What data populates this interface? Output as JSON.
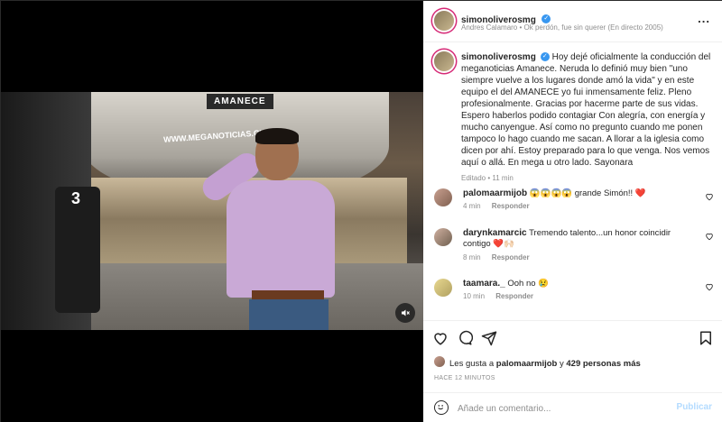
{
  "post": {
    "username": "simonoliverosmg",
    "music": "Andres Calamaro • Ok perdón, fue sin querer (En directo 2005)",
    "caption": "Hoy dejé oficialmente la conducción del meganoticias Amanece. Neruda lo definió muy bien \"uno siempre vuelve a los lugares donde amó la vida\" y en este equipo el del AMANECE yo fui inmensamente feliz. Pleno profesionalmente. Gracias por hacerme parte de sus vidas. Espero haberlos podido contagiar Con alegría, con energía y mucho canyengue. Así como no pregunto cuando me ponen tampoco lo hago cuando me sacan. A llorar a la iglesia como dicen por ahí. Estoy preparado para lo que venga. Nos vemos aquí o allá. En mega u otro lado. Sayonara",
    "caption_meta": "Editado • 11 min"
  },
  "video": {
    "sign_text": "AMANECE",
    "url_text": "WWW.MEGANOTICIAS.CL",
    "camera_number": "3"
  },
  "comments": [
    {
      "user": "palomaarmijob",
      "text": "😱😱😱😱 grande Simón!! ❤️",
      "time": "4 min",
      "reply": "Responder"
    },
    {
      "user": "darynkamarcic",
      "text": "Tremendo talento...un honor coincidir contigo ❤️🙌🏻",
      "time": "8 min",
      "reply": "Responder"
    },
    {
      "user": "taamara._",
      "text": "Ooh no 😢",
      "time": "10 min",
      "reply": "Responder"
    }
  ],
  "likes": {
    "prefix": "Les gusta a",
    "user": "palomaarmijob",
    "middle": "y",
    "count": "429 personas más"
  },
  "time_ago": "HACE 12 MINUTOS",
  "add_comment": {
    "placeholder": "Añade un comentario...",
    "post_label": "Publicar"
  },
  "more_label": "..."
}
